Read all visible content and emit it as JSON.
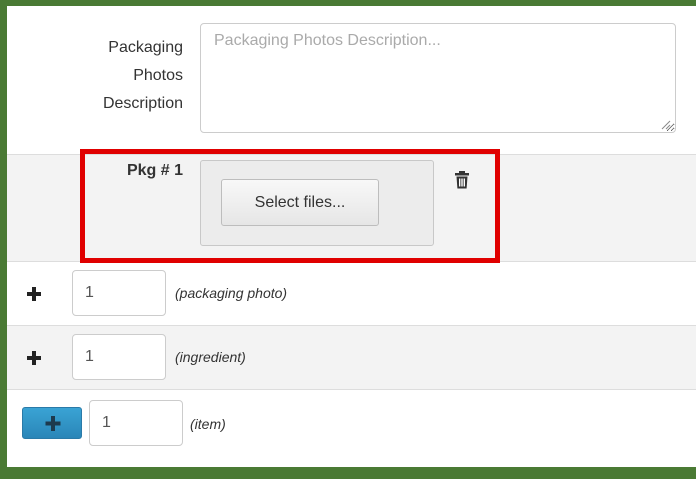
{
  "description": {
    "label": "Packaging\nPhotos\nDescription",
    "placeholder": "Packaging Photos Description...",
    "value": ""
  },
  "package": {
    "label": "Pkg # 1",
    "select_files_label": "Select files..."
  },
  "add_rows": [
    {
      "quantity": "1",
      "hint": "(packaging photo)"
    },
    {
      "quantity": "1",
      "hint": "(ingredient)"
    },
    {
      "quantity": "1",
      "hint": "(item)"
    }
  ],
  "icons": {
    "delete": "trash-icon",
    "add": "plus-icon",
    "resize": "resize-grip-icon"
  },
  "colors": {
    "frame": "#4a7a34",
    "highlight": "#e00000",
    "primary_button": "#2a86b8",
    "row_alt_background": "#f3f3f3"
  }
}
